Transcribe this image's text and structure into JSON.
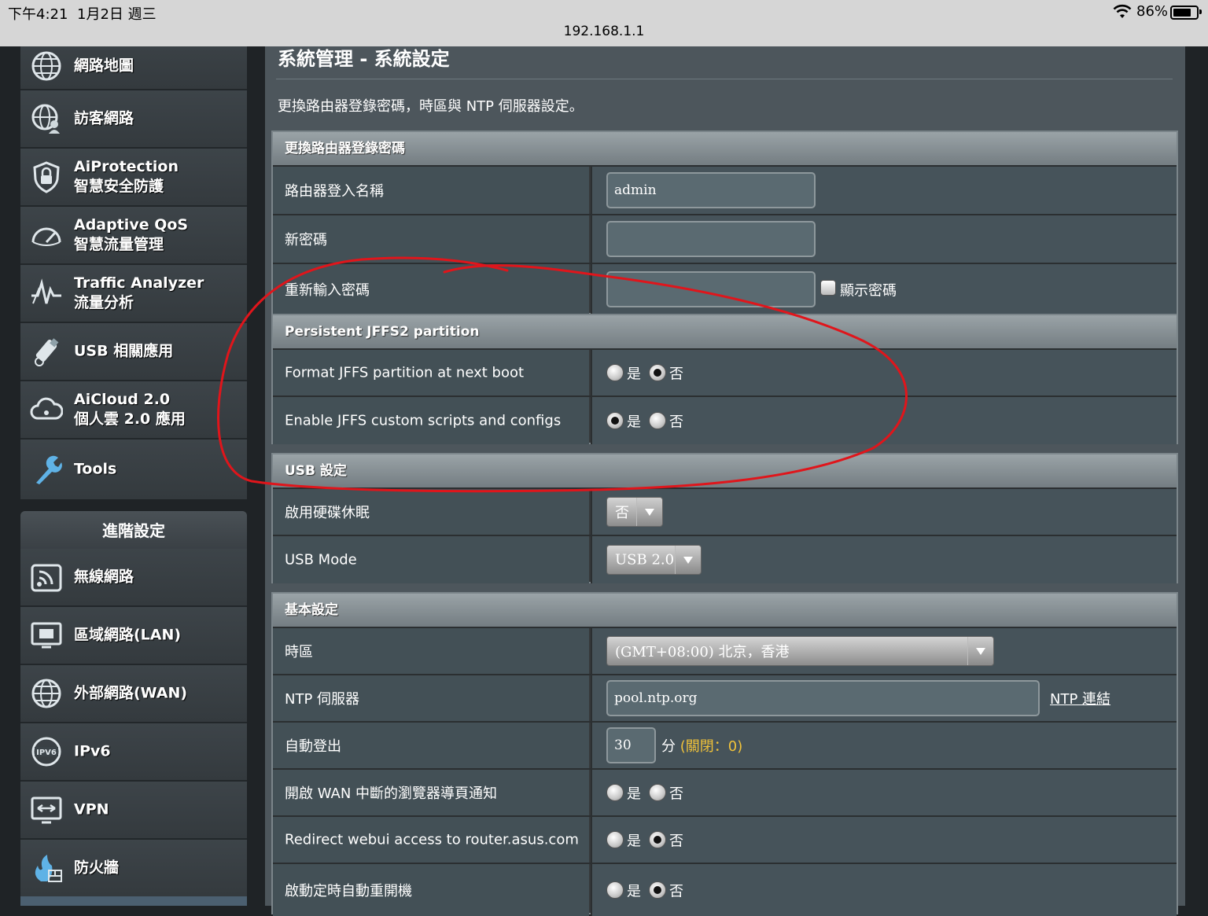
{
  "statusbar": {
    "time": "下午4:21",
    "date": "1月2日 週三",
    "url": "192.168.1.1",
    "battery": "86%",
    "battery_level": 0.86
  },
  "sidebar": {
    "items": [
      {
        "line1": "網路地圖",
        "line2": ""
      },
      {
        "line1": "訪客網路",
        "line2": ""
      },
      {
        "line1": "AiProtection",
        "line2": "智慧安全防護"
      },
      {
        "line1": "Adaptive QoS",
        "line2": "智慧流量管理"
      },
      {
        "line1": "Traffic Analyzer",
        "line2": "流量分析"
      },
      {
        "line1": "USB 相關應用",
        "line2": ""
      },
      {
        "line1": "AiCloud 2.0",
        "line2": "個人雲 2.0 應用"
      },
      {
        "line1": "Tools",
        "line2": ""
      }
    ],
    "advanced_header": "進階設定",
    "advanced_items": [
      {
        "label": "無線網路"
      },
      {
        "label": "區域網路(LAN)"
      },
      {
        "label": "外部網路(WAN)"
      },
      {
        "label": "IPv6"
      },
      {
        "label": "VPN"
      },
      {
        "label": "防火牆"
      }
    ]
  },
  "main": {
    "title": "系統管理 - 系統設定",
    "description": "更換路由器登錄密碼，時區與 NTP 伺服器設定。",
    "password_section": {
      "header": "更換路由器登錄密碼",
      "username_label": "路由器登入名稱",
      "username_value": "admin",
      "new_password_label": "新密碼",
      "new_password_value": "",
      "confirm_label": "重新輸入密碼",
      "confirm_value": "",
      "show_password_label": "顯示密碼"
    },
    "jffs_section": {
      "header": "Persistent JFFS2 partition",
      "format_label": "Format JFFS partition at next boot",
      "format_value": "否",
      "scripts_label": "Enable JFFS custom scripts and configs",
      "scripts_value": "是"
    },
    "usb_section": {
      "header": "USB 設定",
      "hdd_sleep_label": "啟用硬碟休眠",
      "hdd_sleep_value": "否",
      "usb_mode_label": "USB Mode",
      "usb_mode_value": "USB 2.0"
    },
    "basic_section": {
      "header": "基本設定",
      "timezone_label": "時區",
      "timezone_value": "(GMT+08:00) 北京，香港",
      "ntp_label": "NTP 伺服器",
      "ntp_value": "pool.ntp.org",
      "ntp_link": "NTP 連結",
      "logout_label": "自動登出",
      "logout_value": "30",
      "logout_unit": "分",
      "logout_hint": "(關閉：0)",
      "wan_notify_label": "開啟 WAN 中斷的瀏覽器導頁通知",
      "wan_notify_value": "是",
      "redirect_label": "Redirect webui access to router.asus.com",
      "redirect_value": "否",
      "reboot_label": "啟動定時自動重開機",
      "reboot_value": "否"
    },
    "radio_yes": "是",
    "radio_no": "否"
  },
  "colors": {
    "annotation": "#e0151b",
    "hint": "#f0c23a",
    "panel": "#4d565c",
    "header_gradient_top": "#9aa3a7"
  }
}
